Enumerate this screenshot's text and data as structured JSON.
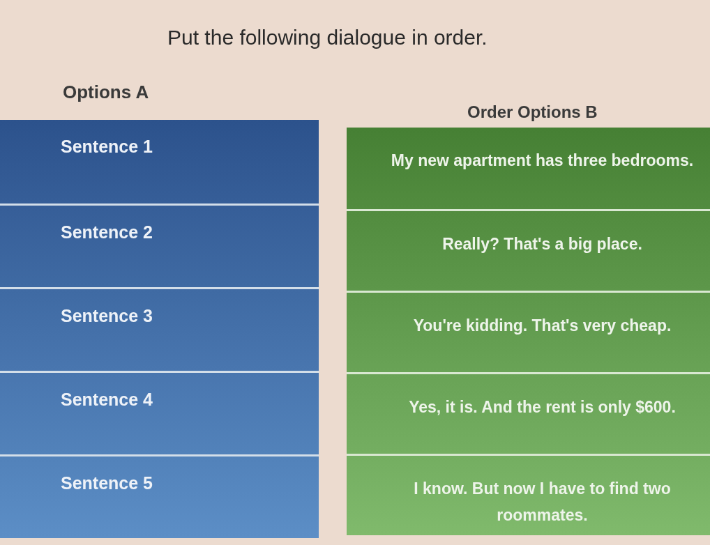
{
  "instruction": "Put the following dialogue in order.",
  "options_a": {
    "heading": "Options A",
    "items": [
      "Sentence 1",
      "Sentence 2",
      "Sentence 3",
      "Sentence 4",
      "Sentence 5"
    ]
  },
  "order_options_b": {
    "heading": "Order Options B",
    "items": [
      "My new apartment has three bedrooms.",
      "Really? That's a big place.",
      "You're kidding. That's very cheap.",
      "Yes, it is. And the rent is only $600.",
      "I know. But now I have to find two roommates."
    ]
  }
}
